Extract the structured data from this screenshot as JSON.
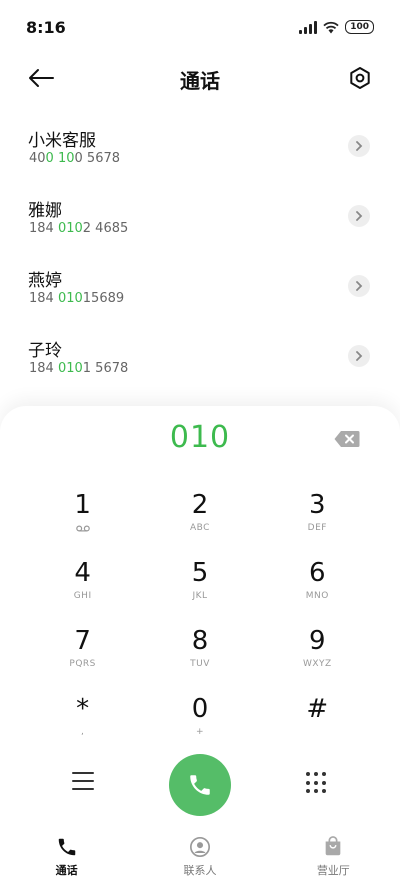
{
  "status_bar": {
    "time": "8:16",
    "battery": "100"
  },
  "header": {
    "title": "通话"
  },
  "contacts": [
    {
      "name": "小米客服",
      "number_pre": "40",
      "number_hl1": "0",
      "number_mid": " ",
      "number_hl2": "10",
      "number_post": "0 5678"
    },
    {
      "name": "雅娜",
      "number_pre": "184 ",
      "number_hl1": "010",
      "number_mid": "",
      "number_hl2": "",
      "number_post": "2 4685"
    },
    {
      "name": "燕婷",
      "number_pre": "184 ",
      "number_hl1": "010",
      "number_mid": "",
      "number_hl2": "",
      "number_post": "15689"
    },
    {
      "name": "子玲",
      "number_pre": "184 ",
      "number_hl1": "010",
      "number_mid": "",
      "number_hl2": "",
      "number_post": "1 5678"
    }
  ],
  "dialer": {
    "input": "010",
    "keys": [
      {
        "digit": "1",
        "sub": ""
      },
      {
        "digit": "2",
        "sub": "ABC"
      },
      {
        "digit": "3",
        "sub": "DEF"
      },
      {
        "digit": "4",
        "sub": "GHI"
      },
      {
        "digit": "5",
        "sub": "JKL"
      },
      {
        "digit": "6",
        "sub": "MNO"
      },
      {
        "digit": "7",
        "sub": "PQRS"
      },
      {
        "digit": "8",
        "sub": "TUV"
      },
      {
        "digit": "9",
        "sub": "WXYZ"
      },
      {
        "digit": "*",
        "sub": ","
      },
      {
        "digit": "0",
        "sub": "+"
      },
      {
        "digit": "#",
        "sub": ""
      }
    ]
  },
  "bottom_nav": [
    {
      "label": "通话",
      "icon": "phone-icon",
      "active": true
    },
    {
      "label": "联系人",
      "icon": "person-icon",
      "active": false
    },
    {
      "label": "营业厅",
      "icon": "bag-icon",
      "active": false
    }
  ],
  "colors": {
    "accent": "#3dba4e",
    "call_button": "#55bd68"
  }
}
